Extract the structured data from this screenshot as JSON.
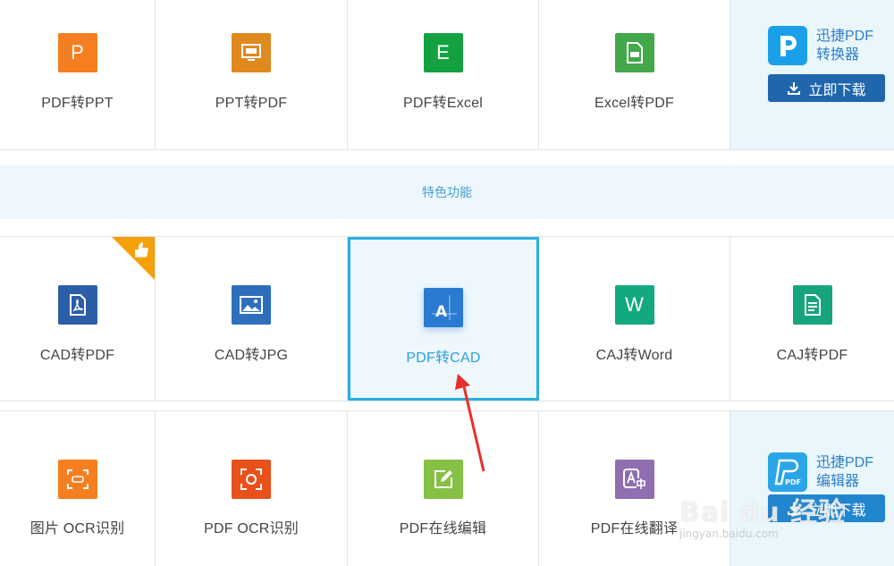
{
  "row1": [
    {
      "label": "PDF转PPT",
      "glyph": "P",
      "color": "#f57f20",
      "icon": "ppt-letter-icon"
    },
    {
      "label": "PPT转PDF",
      "glyph": "",
      "color": "#e0891e",
      "icon": "pdf-screen-icon"
    },
    {
      "label": "PDF转Excel",
      "glyph": "E",
      "color": "#13a23f",
      "icon": "excel-letter-icon"
    },
    {
      "label": "Excel转PDF",
      "glyph": "",
      "color": "#43a84a",
      "icon": "pdf-file-icon"
    }
  ],
  "promo1": {
    "title_line1": "迅捷PDF",
    "title_line2": "转换器",
    "button": "立即下载"
  },
  "banner": "特色功能",
  "row2": [
    {
      "label": "CAD转PDF",
      "color": "#2c5ea8",
      "icon": "acrobat-file-icon"
    },
    {
      "label": "CAD转JPG",
      "color": "#2d6fbd",
      "icon": "image-icon"
    },
    {
      "label": "PDF转CAD",
      "glyph": "A",
      "color": "#2a7ad1",
      "icon": "cad-letter-icon"
    },
    {
      "label": "CAJ转Word",
      "glyph": "W",
      "color": "#13a97f",
      "icon": "word-letter-icon"
    },
    {
      "label": "CAJ转PDF",
      "color": "#17a57e",
      "icon": "document-icon"
    }
  ],
  "row3": [
    {
      "label": "图片 OCR识别",
      "color": "#f57f20",
      "icon": "scan-text-icon"
    },
    {
      "label": "PDF OCR识别",
      "color": "#e8501c",
      "icon": "scan-target-icon"
    },
    {
      "label": "PDF在线编辑",
      "color": "#86c045",
      "icon": "edit-icon"
    },
    {
      "label": "PDF在线翻译",
      "color": "#8f6fb0",
      "icon": "translate-icon"
    }
  ],
  "promo2": {
    "title_line1": "迅捷PDF",
    "title_line2": "编辑器",
    "button": "立即下载",
    "logo_text": "PDF"
  },
  "watermark": {
    "main": "Bai du 经验",
    "sub": "jingyan.baidu.com"
  }
}
